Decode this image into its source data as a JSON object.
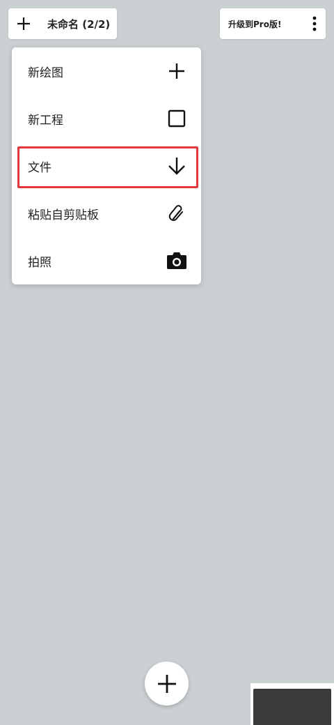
{
  "header": {
    "new_icon": "plus-icon",
    "title": "未命名 (2/2)",
    "upgrade_label": "升级到Pro版!",
    "more_icon": "more-vertical-icon"
  },
  "menu": {
    "items": [
      {
        "label": "新绘图",
        "icon": "plus-icon"
      },
      {
        "label": "新工程",
        "icon": "square-icon"
      },
      {
        "label": "文件",
        "icon": "arrow-down-icon"
      },
      {
        "label": "粘贴自剪贴板",
        "icon": "paperclip-icon"
      },
      {
        "label": "拍照",
        "icon": "camera-icon"
      }
    ],
    "highlighted_index": 2
  },
  "fab": {
    "icon": "plus-icon"
  },
  "colors": {
    "canvas_bg": "#cbd0d3",
    "surface": "#ffffff",
    "highlight_border": "#e2363f",
    "icon": "#111111"
  }
}
